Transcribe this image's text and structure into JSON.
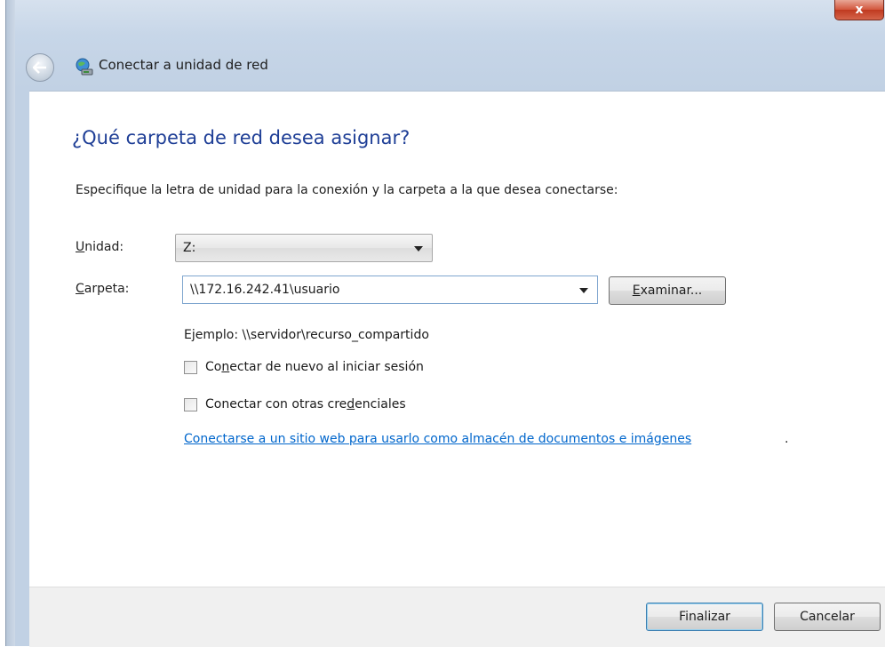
{
  "window": {
    "title": "Conectar a unidad de red",
    "close_label": "x",
    "back_icon": "back-arrow-icon",
    "app_icon": "network-drive-icon"
  },
  "main": {
    "heading": "¿Qué carpeta de red desea asignar?",
    "instructions": "Especifique la letra de unidad para la conexión y la carpeta a la que desea conectarse:",
    "unidad": {
      "label_prefix": "",
      "label_mnemonic": "U",
      "label_rest": "nidad:",
      "value": "Z:"
    },
    "carpeta": {
      "label_mnemonic": "C",
      "label_rest": "arpeta:",
      "value": "\\\\172.16.242.41\\usuario",
      "browse_mnemonic": "E",
      "browse_rest": "xaminar..."
    },
    "example": "Ejemplo: \\\\servidor\\recurso_compartido",
    "reconnect": {
      "pre": "Co",
      "mnemonic": "n",
      "post": "ectar de nuevo al iniciar sesión",
      "checked": false
    },
    "credentials": {
      "pre": "Conectar con otras cre",
      "mnemonic": "d",
      "post": "enciales",
      "checked": false
    },
    "link": "Conectarse a un sitio web para usarlo como almacén de documentos e imágenes",
    "link_suffix": "."
  },
  "footer": {
    "finish": "Finalizar",
    "cancel": "Cancelar"
  },
  "colors": {
    "heading": "#1e3e96",
    "link": "#0066cc",
    "close": "#c03a20"
  }
}
